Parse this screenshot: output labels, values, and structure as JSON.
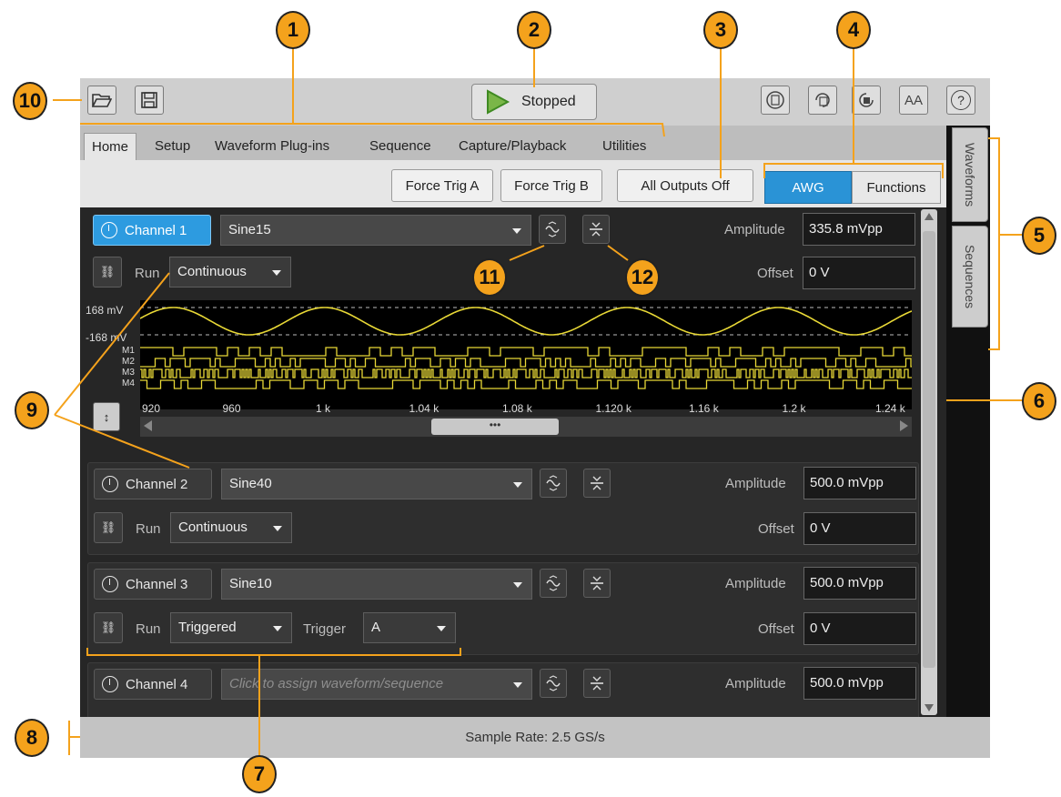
{
  "callouts": [
    "1",
    "2",
    "3",
    "4",
    "5",
    "6",
    "7",
    "8",
    "9",
    "10",
    "11",
    "12"
  ],
  "toolbar": {
    "open_icon": "folder-open-icon",
    "save_icon": "save-icon",
    "run_state": "Stopped",
    "right_icons": [
      "recall-setup-icon",
      "save-setup-icon",
      "reset-icon",
      "font-size-icon",
      "help-icon"
    ],
    "font_label": "AA",
    "help_label": "?"
  },
  "tabs": [
    "Home",
    "Setup",
    "Waveform Plug-ins",
    "Sequence",
    "Capture/Playback",
    "Utilities"
  ],
  "ribbon": {
    "force_trig_a": "Force Trig A",
    "force_trig_b": "Force Trig B",
    "all_outputs_off": "All Outputs Off",
    "mode_awg": "AWG",
    "mode_functions": "Functions"
  },
  "side_tabs": [
    "Waveforms",
    "Sequences"
  ],
  "channels": [
    {
      "label": "Channel 1",
      "waveform": "Sine15",
      "run_label": "Run",
      "run_mode": "Continuous",
      "amplitude_label": "Amplitude",
      "amplitude": "335.8 mVpp",
      "offset_label": "Offset",
      "offset": "0 V",
      "enabled": true
    },
    {
      "label": "Channel 2",
      "waveform": "Sine40",
      "run_label": "Run",
      "run_mode": "Continuous",
      "amplitude_label": "Amplitude",
      "amplitude": "500.0 mVpp",
      "offset_label": "Offset",
      "offset": "0 V",
      "enabled": false
    },
    {
      "label": "Channel 3",
      "waveform": "Sine10",
      "run_label": "Run",
      "run_mode": "Triggered",
      "trigger_label": "Trigger",
      "trigger": "A",
      "amplitude_label": "Amplitude",
      "amplitude": "500.0 mVpp",
      "offset_label": "Offset",
      "offset": "0 V",
      "enabled": false
    },
    {
      "label": "Channel 4",
      "waveform_placeholder": "Click to assign waveform/sequence",
      "amplitude_label": "Amplitude",
      "amplitude": "500.0 mVpp",
      "enabled": false
    }
  ],
  "scope": {
    "y_top": "168 mV",
    "y_bottom": "-168 mV",
    "markers": [
      "M1",
      "M2",
      "M3",
      "M4"
    ],
    "x_ticks": [
      "920",
      "960",
      "1 k",
      "1.04 k",
      "1.08 k",
      "1.120 k",
      "1.16 k",
      "1.2 k",
      "1.24 k"
    ],
    "scroll_thumb": "•••",
    "trace_color": "#e8d836"
  },
  "status": {
    "sample_rate": "Sample Rate: 2.5 GS/s"
  }
}
